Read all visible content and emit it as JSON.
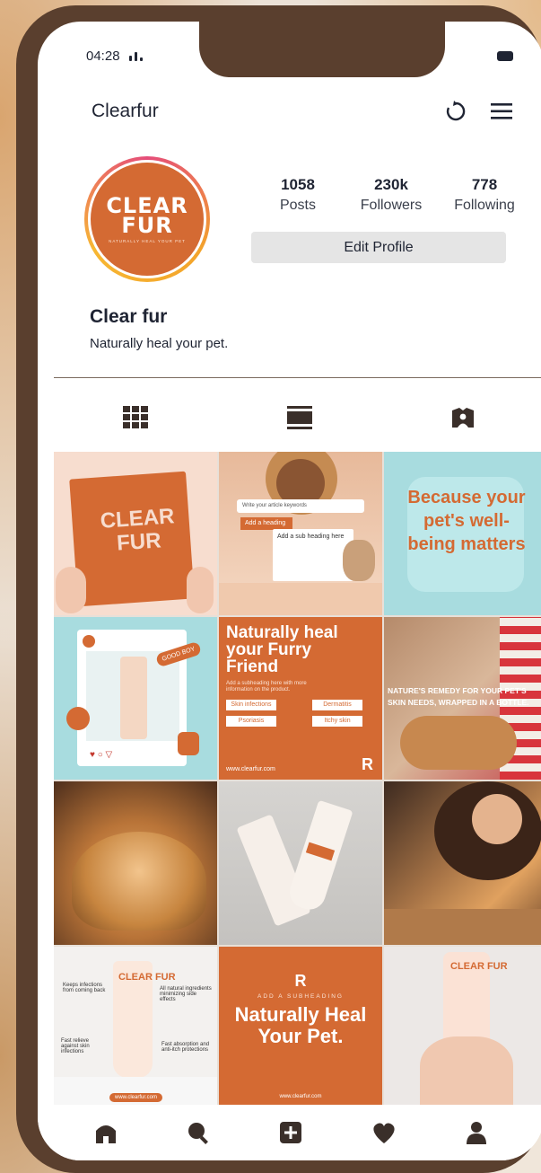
{
  "status": {
    "time": "04:28"
  },
  "header": {
    "app_name": "Clearfur"
  },
  "profile": {
    "avatar_logo_line1": "CLEAR",
    "avatar_logo_line2": "FUR",
    "avatar_tagline": "NATURALLY HEAL YOUR PET",
    "name": "Clear fur",
    "bio": "Naturally heal your pet.",
    "edit_label": "Edit Profile"
  },
  "stats": [
    {
      "value": "1058",
      "label": "Posts"
    },
    {
      "value": "230k",
      "label": "Followers"
    },
    {
      "value": "778",
      "label": "Following"
    }
  ],
  "posts": {
    "p1_logo": "CLEAR FUR",
    "p2_search": "Write your article keywords",
    "p2_heading": "Add a heading",
    "p2_sub": "Add a sub heading here",
    "p3_text": "Because your pet's well-being matters",
    "p4_badge": "GOOD BOY",
    "p5_title": "Naturally heal your Furry Friend",
    "p5_sub": "Add a subheading here with more information on the product.",
    "p5_chips": [
      "Skin infections",
      "Dermatitis",
      "Psoriasis",
      "Itchy skin"
    ],
    "p5_url": "www.clearfur.com",
    "p6_text": "NATURE'S REMEDY FOR YOUR PET'S SKIN NEEDS, WRAPPED IN A BOTTLE.",
    "p11_sub": "ADD A SUBHEADING",
    "p11_title": "Naturally Heal Your Pet.",
    "p11_url": "www.clearfur.com",
    "p10_url": "www.clearfur.com"
  },
  "colors": {
    "brand_orange": "#d46a33",
    "teal": "#a8dcdf",
    "frame_brown": "#5a3f2e",
    "text_dark": "#1f2433"
  }
}
